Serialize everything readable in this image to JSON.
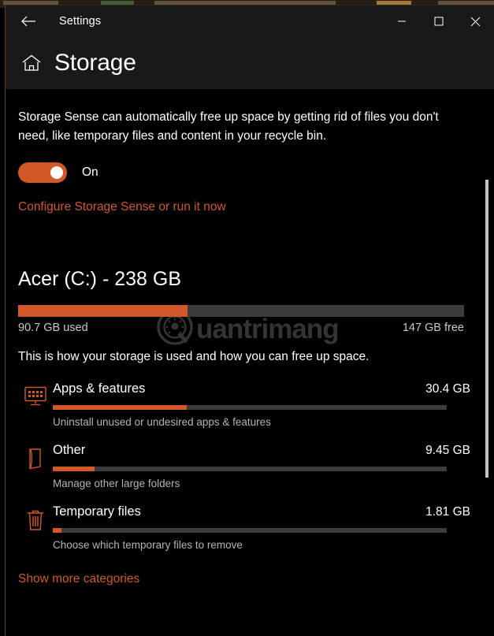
{
  "window": {
    "app_title": "Settings",
    "back_icon": "back-arrow-icon",
    "minimize_label": "Minimize",
    "maximize_label": "Maximize",
    "close_label": "Close"
  },
  "header": {
    "home_icon": "home-icon",
    "title": "Storage"
  },
  "storage_sense": {
    "description": "Storage Sense can automatically free up space by getting rid of files you don't need, like temporary files and content in your recycle bin.",
    "toggle_state": "On",
    "toggle_on": true,
    "configure_link": "Configure Storage Sense or run it now"
  },
  "watermark": {
    "text": "uantrimang",
    "full_text": "Quantrimang"
  },
  "drive": {
    "title": "Acer (C:) - 238 GB",
    "name": "Acer (C:)",
    "capacity": "238 GB",
    "used_label": "90.7 GB used",
    "free_label": "147 GB free",
    "used_percent": 38,
    "note": "This is how your storage is used and how you can free up space."
  },
  "categories": [
    {
      "icon": "apps-monitor-icon",
      "name": "Apps & features",
      "size": "30.4 GB",
      "percent": 34,
      "subtitle": "Uninstall unused or undesired apps & features"
    },
    {
      "icon": "folder-other-icon",
      "name": "Other",
      "size": "9.45 GB",
      "percent": 10.5,
      "subtitle": "Manage other large folders"
    },
    {
      "icon": "trash-can-icon",
      "name": "Temporary files",
      "size": "1.81 GB",
      "percent": 2.2,
      "subtitle": "Choose which temporary files to remove"
    }
  ],
  "footer": {
    "show_more_link": "Show more categories"
  },
  "colors": {
    "accent": "#d2582a",
    "track": "#3b3b3b",
    "window_bg": "#000000",
    "chrome_bg": "#191919",
    "text": "#ffffff",
    "subtext": "#b3b3b3"
  }
}
